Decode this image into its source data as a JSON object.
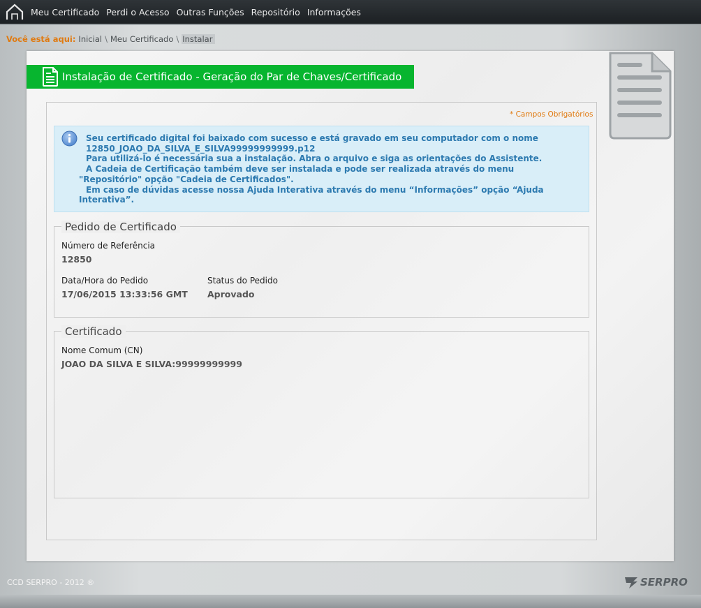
{
  "nav": {
    "items": [
      "Meu Certificado",
      "Perdi o Acesso",
      "Outras Funções",
      "Repositório",
      "Informações"
    ]
  },
  "breadcrumb": {
    "label": "Você está aqui:",
    "items": [
      "Inicial",
      "Meu Certificado",
      "Instalar"
    ]
  },
  "page": {
    "title": "Instalação de Certificado - Geração do Par de Chaves/Certificado",
    "required_note": "* Campos Obrigatórios"
  },
  "info": {
    "lines": [
      "Seu certificado digital foi baixado com sucesso e está gravado em seu computador com o nome",
      "12850_JOAO_DA_SILVA_E_SILVA99999999999.p12",
      "Para utilizá-lo é necessária sua a instalação. Abra o arquivo e siga as orientações do Assistente.",
      "A Cadeia de Certificação também deve ser instalada e pode ser realizada através do menu",
      "\"Repositório\" opção \"Cadeia de Certificados\".",
      "Em caso de dúvidas acesse nossa Ajuda Interativa através do menu “Informações” opção “Ajuda",
      "Interativa”."
    ]
  },
  "pedido": {
    "legend": "Pedido de Certificado",
    "ref_label": "Número de Referência",
    "ref_value": "12850",
    "date_label": "Data/Hora do Pedido",
    "date_value": "17/06/2015 13:33:56 GMT",
    "status_label": "Status do Pedido",
    "status_value": "Aprovado"
  },
  "certificado": {
    "legend": "Certificado",
    "cn_label": "Nome Comum (CN)",
    "cn_value": "JOAO DA SILVA E SILVA:99999999999"
  },
  "footer": {
    "copyright": "CCD SERPRO - 2012 ®",
    "logo": "SERPRO"
  },
  "colors": {
    "accent_green": "#07b52f",
    "accent_orange": "#e07a10",
    "info_text": "#2d7ab0"
  }
}
